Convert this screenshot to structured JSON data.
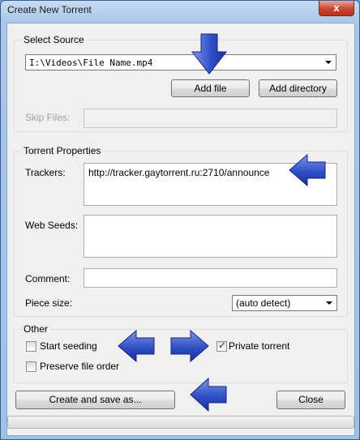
{
  "window": {
    "title": "Create New Torrent",
    "close_glyph": "x"
  },
  "select_source": {
    "label": "Select Source",
    "source_value": "I:\\Videos\\File Name.mp4",
    "add_file_label": "Add file",
    "add_directory_label": "Add directory",
    "skip_files_label": "Skip Files:",
    "skip_files_value": ""
  },
  "torrent_properties": {
    "label": "Torrent Properties",
    "trackers_label": "Trackers:",
    "trackers_value": "http://tracker.gaytorrent.ru:2710/announce",
    "web_seeds_label": "Web Seeds:",
    "web_seeds_value": "",
    "comment_label": "Comment:",
    "comment_value": "",
    "piece_size_label": "Piece size:",
    "piece_size_value": "(auto detect)"
  },
  "other": {
    "label": "Other",
    "start_seeding_label": "Start seeding",
    "start_seeding_checked": false,
    "private_torrent_label": "Private torrent",
    "private_torrent_checked": true,
    "preserve_order_label": "Preserve file order",
    "preserve_order_checked": false
  },
  "actions": {
    "create_label": "Create and save as...",
    "close_label": "Close"
  },
  "progress": {
    "fraction": 0
  },
  "annotation": {
    "arrow_color": "#1e3fb8",
    "icon": "blue-arrow-icon"
  }
}
